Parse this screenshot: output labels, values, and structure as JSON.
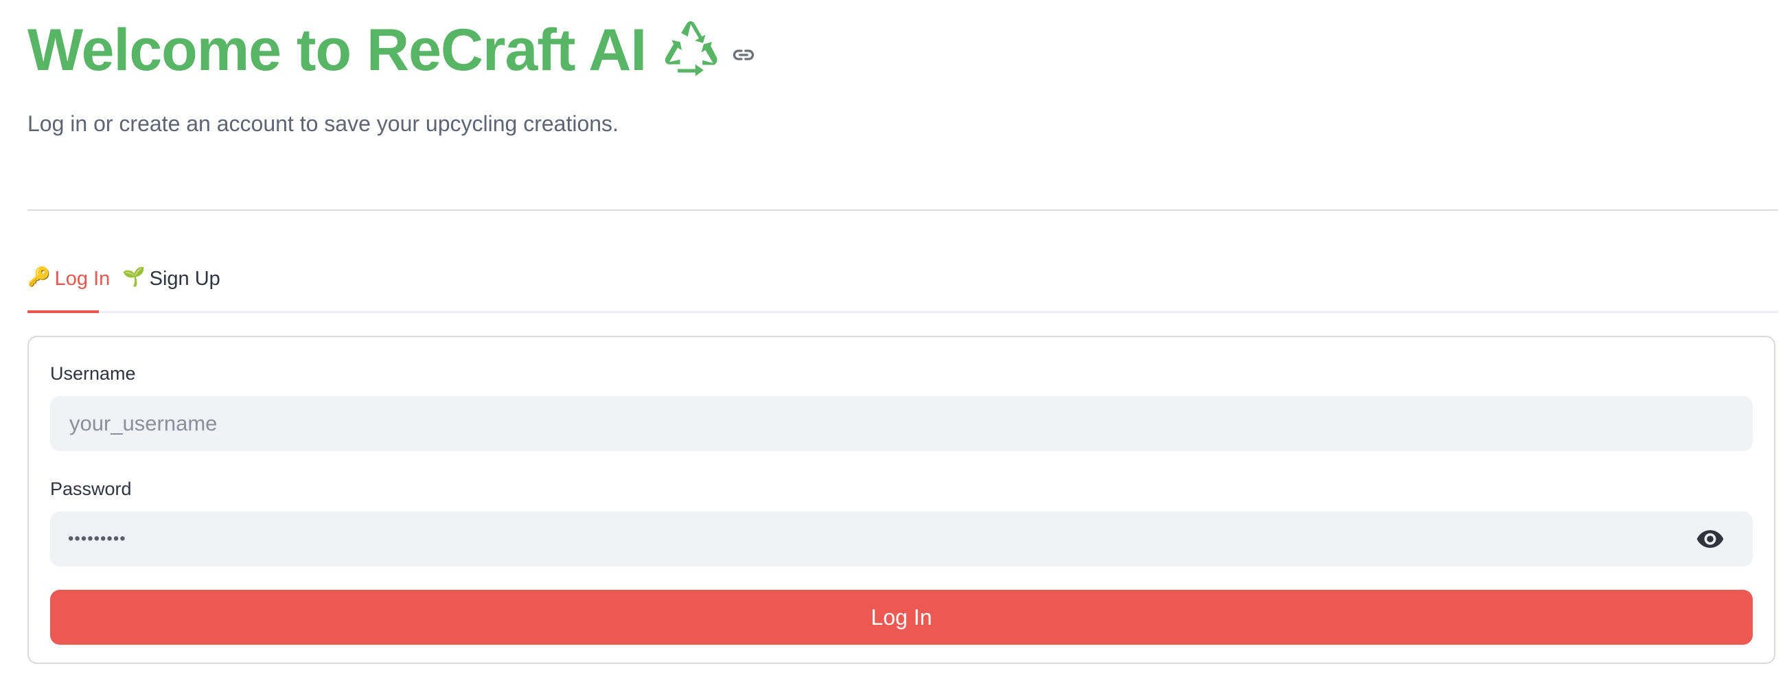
{
  "header": {
    "title": "Welcome to ReCraft AI",
    "title_color": "#58b565",
    "title_icon": "recycle-icon",
    "anchor_icon": "link-icon",
    "subtitle": "Log in or create an account to save your upcycling creations."
  },
  "tabs": [
    {
      "icon": "🔑",
      "icon_name": "key-icon",
      "label": "Log In",
      "active": true
    },
    {
      "icon": "🌱",
      "icon_name": "seedling-icon",
      "label": "Sign Up",
      "active": false
    }
  ],
  "form": {
    "username": {
      "label": "Username",
      "placeholder": "your_username",
      "value": ""
    },
    "password": {
      "label": "Password",
      "masked_value": "•••••••••",
      "toggle_icon": "eye-icon"
    },
    "submit_label": "Log In"
  },
  "colors": {
    "accent": "#ec5953",
    "brand_green": "#58b565",
    "input_bg": "#f0f2f6"
  }
}
